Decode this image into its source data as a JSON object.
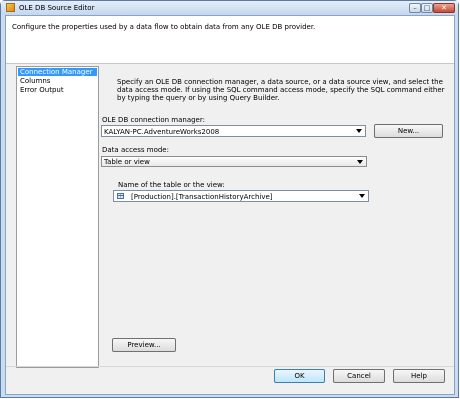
{
  "window": {
    "title": "OLE DB Source Editor"
  },
  "header": {
    "text": "Configure the properties used by a data flow to obtain data from any OLE DB provider."
  },
  "nav": {
    "items": [
      "Connection Manager",
      "Columns",
      "Error Output"
    ],
    "selected": "Connection Manager"
  },
  "description": "Specify an OLE DB connection manager, a data source, or a data source view, and select the data access mode. If using the SQL command access mode, specify the SQL command either by typing the query or by using Query Builder.",
  "connection": {
    "label": "OLE DB connection manager:",
    "value": "KALYAN-PC.AdventureWorks2008",
    "new_label": "New..."
  },
  "access_mode": {
    "label": "Data access mode:",
    "value": "Table or view"
  },
  "table": {
    "label": "Name of the table or the view:",
    "value": "[Production].[TransactionHistoryArchive]"
  },
  "buttons": {
    "preview": "Preview...",
    "ok": "OK",
    "cancel": "Cancel",
    "help": "Help"
  },
  "icons": {
    "app": "ssis-component-icon",
    "table": "table-icon",
    "dropdown": "chevron-down-icon"
  }
}
